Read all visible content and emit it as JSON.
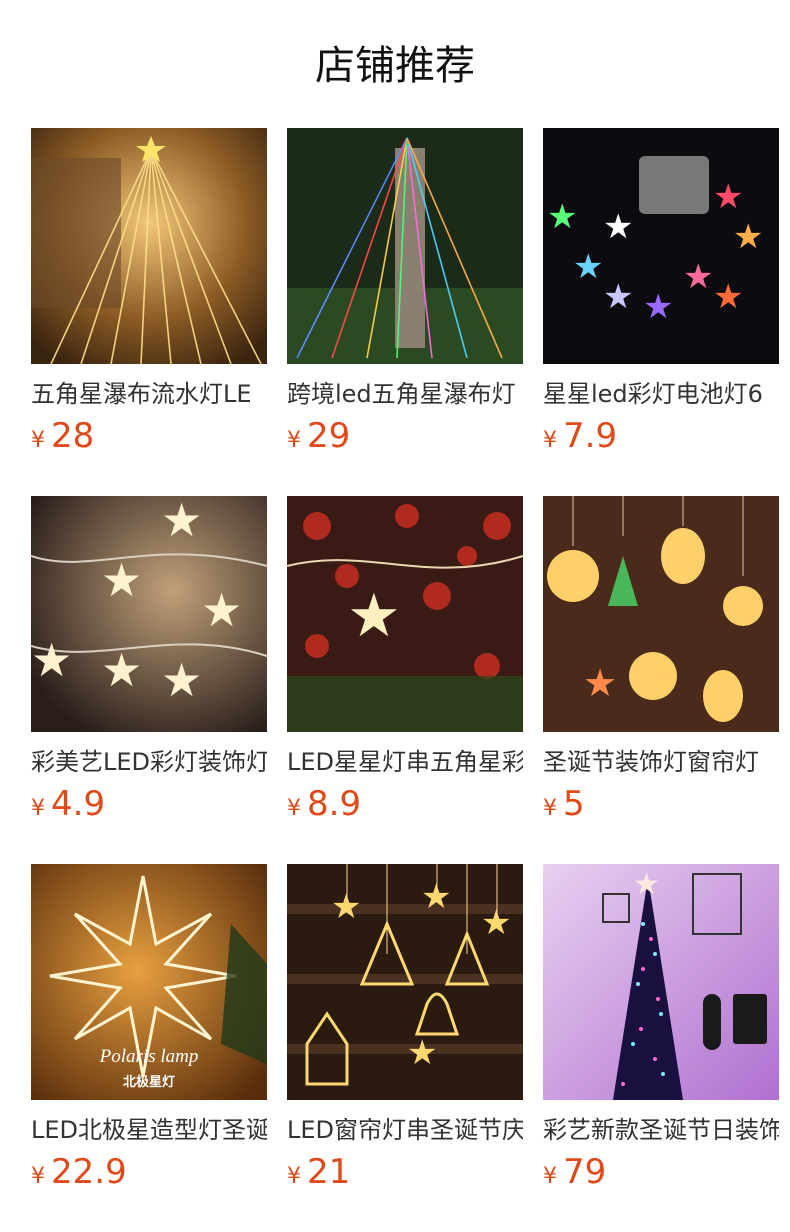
{
  "page": {
    "title": "店铺推荐"
  },
  "products": [
    {
      "name": "五角星瀑布流水灯LE",
      "currency": "¥",
      "price": "28",
      "image": "golden-star-waterfall-lights"
    },
    {
      "name": "跨境led五角星瀑布灯",
      "currency": "¥",
      "price": "29",
      "image": "multicolor-tree-waterfall-lights"
    },
    {
      "name": "星星led彩灯电池灯6",
      "currency": "¥",
      "price": "7.9",
      "image": "battery-star-string-lights"
    },
    {
      "name": "彩美艺LED彩灯装饰灯",
      "currency": "¥",
      "price": "4.9",
      "image": "star-string-lights-closeup"
    },
    {
      "name": "LED星星灯串五角星彩",
      "currency": "¥",
      "price": "8.9",
      "image": "star-lights-with-flowers"
    },
    {
      "name": "圣诞节装饰灯窗帘灯",
      "currency": "¥",
      "price": "5",
      "image": "christmas-window-suction-lights"
    },
    {
      "name": "LED北极星造型灯圣诞",
      "currency": "¥",
      "price": "22.9",
      "image": "polaris-star-lamp"
    },
    {
      "name": "LED窗帘灯串圣诞节庆",
      "currency": "¥",
      "price": "21",
      "image": "curtain-string-lights"
    },
    {
      "name": "彩艺新款圣诞节日装饰",
      "currency": "¥",
      "price": "79",
      "image": "rgb-christmas-tree-lamp"
    }
  ],
  "image_text": {
    "polaris_line1": "Polaris lamp",
    "polaris_line2": "北极星灯"
  },
  "colors": {
    "price": "#e0491a",
    "warm_glow": "#ffd27a"
  }
}
